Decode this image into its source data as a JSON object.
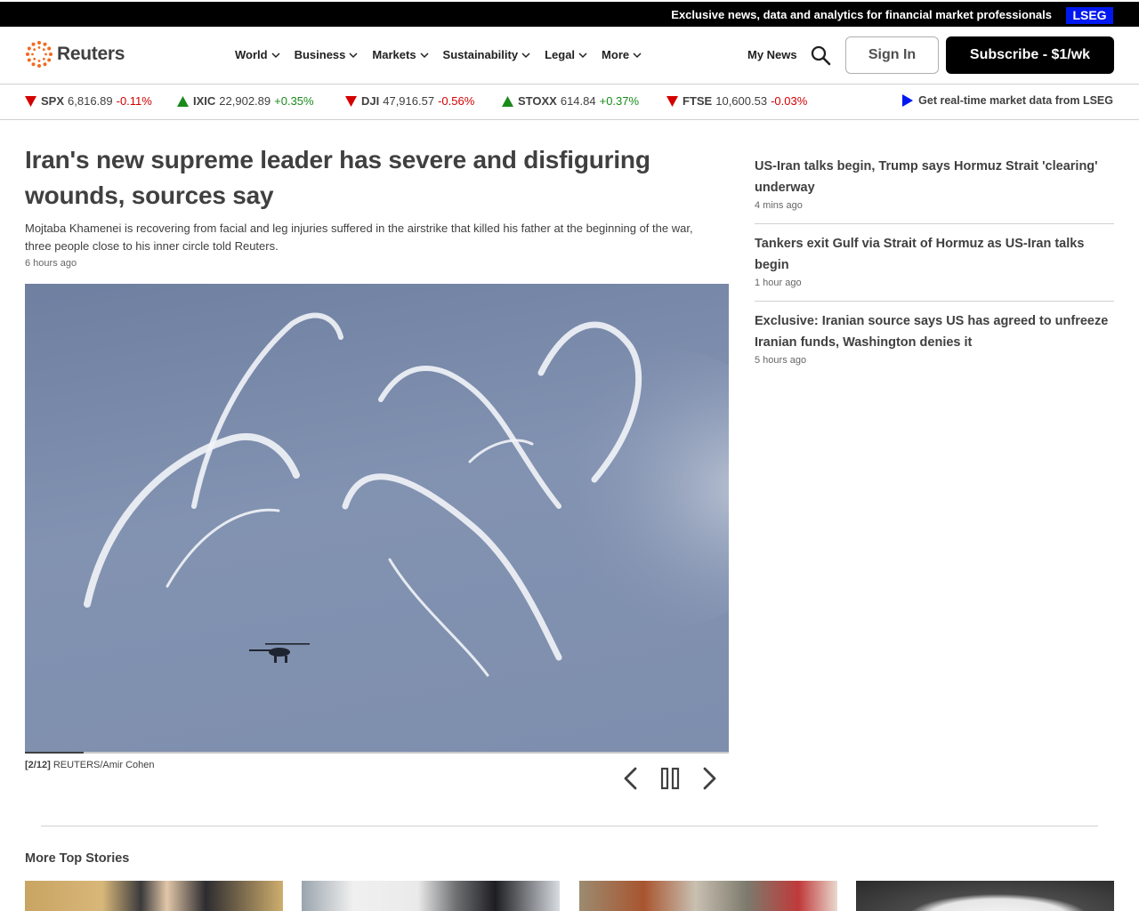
{
  "banner": {
    "text": "Exclusive news, data and analytics for financial market professionals",
    "badge": "LSEG"
  },
  "header": {
    "logo_text": "Reuters",
    "nav": [
      {
        "label": "World"
      },
      {
        "label": "Business"
      },
      {
        "label": "Markets"
      },
      {
        "label": "Sustainability"
      },
      {
        "label": "Legal"
      },
      {
        "label": "More"
      }
    ],
    "my_news": "My News",
    "sign_in": "Sign In",
    "subscribe": "Subscribe - $1/wk"
  },
  "ticker": {
    "items": [
      {
        "name": "SPX",
        "value": "6,816.89",
        "change": "-0.11%",
        "direction": "down"
      },
      {
        "name": "IXIC",
        "value": "22,902.89",
        "change": "+0.35%",
        "direction": "up"
      },
      {
        "name": "DJI",
        "value": "47,916.57",
        "change": "-0.56%",
        "direction": "down"
      },
      {
        "name": "STOXX",
        "value": "614.84",
        "change": "+0.37%",
        "direction": "up"
      },
      {
        "name": "FTSE",
        "value": "10,600.53",
        "change": "-0.03%",
        "direction": "down"
      }
    ],
    "lseg_link": "Get real-time market data from LSEG"
  },
  "main_story": {
    "headline": "Iran's new supreme leader has severe and disfiguring wounds, sources say",
    "summary": "Mojtaba Khamenei is recovering from facial and leg injuries suffered in the airstrike that killed his father at the beginning of the war, three people close to his inner circle told Reuters.",
    "timestamp": "6 hours ago",
    "gallery": {
      "position": "[2/12]",
      "credit": "REUTERS/Amir Cohen",
      "current": 2,
      "total": 12
    }
  },
  "sidebar": {
    "items": [
      {
        "title": "US-Iran talks begin, Trump says Hormuz Strait 'clearing' underway",
        "timestamp": "4 mins ago"
      },
      {
        "title": "Tankers exit Gulf via Strait of Hormuz as US-Iran talks begin",
        "timestamp": "1 hour ago"
      },
      {
        "title": "Exclusive: Iranian source says US has agreed to unfreeze Iranian funds, Washington denies it",
        "timestamp": "5 hours ago"
      }
    ]
  },
  "more_top_stories": {
    "title": "More Top Stories"
  },
  "colors": {
    "negative": "#d40000",
    "positive": "#1a8a1a",
    "accent": "#0018f0",
    "brand": "#f26a21"
  },
  "icons": [
    "search-icon",
    "chevron-down-icon",
    "chevron-left-icon",
    "pause-icon",
    "chevron-right-icon",
    "triangle-down-icon",
    "triangle-up-icon",
    "play-icon"
  ]
}
